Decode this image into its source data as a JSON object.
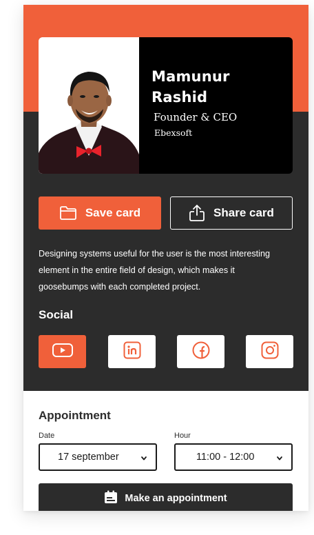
{
  "profile": {
    "name_line1": "Mamunur",
    "name_line2": "Rashid",
    "title": "Founder & CEO",
    "company": "Ebexsoft"
  },
  "actions": {
    "save_label": "Save card",
    "share_label": "Share card"
  },
  "bio": "Designing systems useful for the user is the most interesting element in the entire field of design, which makes it goosebumps with each completed project.",
  "social": {
    "title": "Social",
    "items": [
      {
        "icon": "youtube-icon",
        "active": true
      },
      {
        "icon": "linkedin-icon",
        "active": false
      },
      {
        "icon": "facebook-icon",
        "active": false
      },
      {
        "icon": "instagram-icon",
        "active": false
      }
    ]
  },
  "appointment": {
    "title": "Appointment",
    "date_label": "Date",
    "date_value": "17 september",
    "hour_label": "Hour",
    "hour_value": "11:00 - 12:00",
    "button_label": "Make an appointment"
  },
  "colors": {
    "accent": "#F0603A",
    "dark": "#2C2C2C",
    "card": "#000000",
    "white": "#FFFFFF"
  }
}
